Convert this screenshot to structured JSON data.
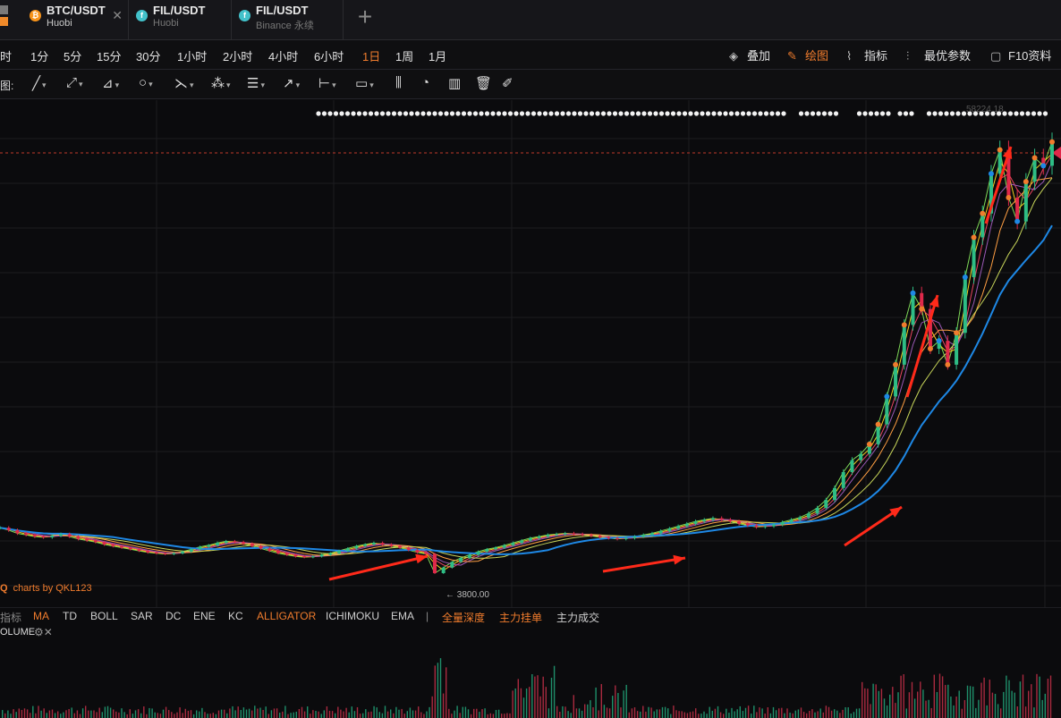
{
  "tabs": [
    {
      "symbol": "BTC/USDT",
      "exchange": "Huobi",
      "coin_color": "#f7931a",
      "coin_glyph": "₿",
      "closable": true
    },
    {
      "symbol": "FIL/USDT",
      "exchange": "Huobi",
      "coin_color": "#42c1ca",
      "coin_glyph": "f"
    },
    {
      "symbol": "FIL/USDT",
      "exchange": "Binance",
      "exchange_suffix": "永续",
      "coin_color": "#42c1ca",
      "coin_glyph": "f"
    }
  ],
  "add_tab_icon": "plus-icon",
  "intervals": [
    "时",
    "1分",
    "5分",
    "15分",
    "30分",
    "1小时",
    "2小时",
    "4小时",
    "6小时",
    "1日",
    "1周",
    "1月"
  ],
  "active_interval": "1日",
  "right_tools": [
    {
      "icon": "layers-icon",
      "label": "叠加"
    },
    {
      "icon": "pen-icon",
      "label": "绘图",
      "active": true
    },
    {
      "icon": "chart-line-icon",
      "label": "指标"
    },
    {
      "icon": "sliders-icon",
      "label": "最优参数"
    },
    {
      "icon": "doc-icon",
      "label": "F10资料"
    }
  ],
  "draw_label": "图:",
  "draw_tools": [
    "line-tool-icon",
    "ray-tool-icon",
    "channel-tool-icon",
    "circle-tool-icon",
    "wave-tool-icon",
    "pattern-tool-icon",
    "fib-tool-icon",
    "arrow-tool-icon",
    "measure-tool-icon",
    "comment-tool-icon",
    "candle-tool-icon",
    "pie-tool-icon",
    "bars-tool-icon",
    "trash-icon",
    "eraser-icon"
  ],
  "indicators": [
    {
      "label": "指标",
      "dim": true
    },
    {
      "label": "MA",
      "on": true
    },
    {
      "label": "TD"
    },
    {
      "label": "BOLL"
    },
    {
      "label": "SAR"
    },
    {
      "label": "DC"
    },
    {
      "label": "ENE"
    },
    {
      "label": "KC"
    },
    {
      "label": "ALLIGATOR",
      "on": true
    },
    {
      "label": "ICHIMOKU"
    },
    {
      "label": "EMA"
    },
    {
      "label": "|",
      "dim": true
    },
    {
      "label": "全量深度",
      "on": true
    },
    {
      "label": "主力挂单",
      "on": true
    },
    {
      "label": "主力成交"
    }
  ],
  "volume_label": "OLUME",
  "credit": "charts by QKL123",
  "low_label": "← 3800.00",
  "high_label": "58224.18",
  "colors": {
    "accent": "#f07c2d",
    "up": "#2ebd85",
    "down": "#e0294a",
    "arrow": "#ff2a1a",
    "ma_long": "#1e88e5"
  },
  "chart_data": {
    "type": "line",
    "title": "",
    "xlabel": "",
    "ylabel": "",
    "ylim": [
      3000,
      62000
    ],
    "annotations": [
      "← 3800.00",
      "58224.18"
    ],
    "series": [
      {
        "values": [
          10500,
          10200,
          9800,
          9600,
          9400,
          9300,
          9500,
          9700,
          9400,
          9100,
          8900,
          8700,
          8400,
          8200,
          8000,
          7800,
          7600,
          7400,
          7300,
          7200,
          7300,
          7500,
          7800,
          8100,
          8300,
          8600,
          8800,
          8700,
          8500,
          8200,
          7900,
          7600,
          7300,
          7100,
          6900,
          6800,
          6900,
          7100,
          7300,
          7600,
          7900,
          8200,
          8400,
          8600,
          8400,
          8200,
          8000,
          7700,
          7400,
          7200,
          4800,
          5500,
          6200,
          6700,
          7100,
          7500,
          7800,
          8000,
          8300,
          8600,
          8900,
          9200,
          9400,
          9600,
          9700,
          9800,
          9700,
          9600,
          9500,
          9300,
          9200,
          9100,
          9200,
          9400,
          9600,
          9800,
          10100,
          10400,
          10700,
          11000,
          11300,
          11500,
          11700,
          11500,
          11300,
          11000,
          10800,
          10600,
          10700,
          10900,
          11200,
          11500,
          11800,
          12300,
          13000,
          14000,
          15500,
          17500,
          19000,
          19800,
          21000,
          23500,
          27000,
          31000,
          36000,
          40000,
          38000,
          33000,
          34000,
          31000,
          35000,
          42000,
          47000,
          50000,
          55000,
          58000,
          52000,
          49000,
          54000,
          57000,
          56000,
          59000
        ]
      }
    ]
  }
}
